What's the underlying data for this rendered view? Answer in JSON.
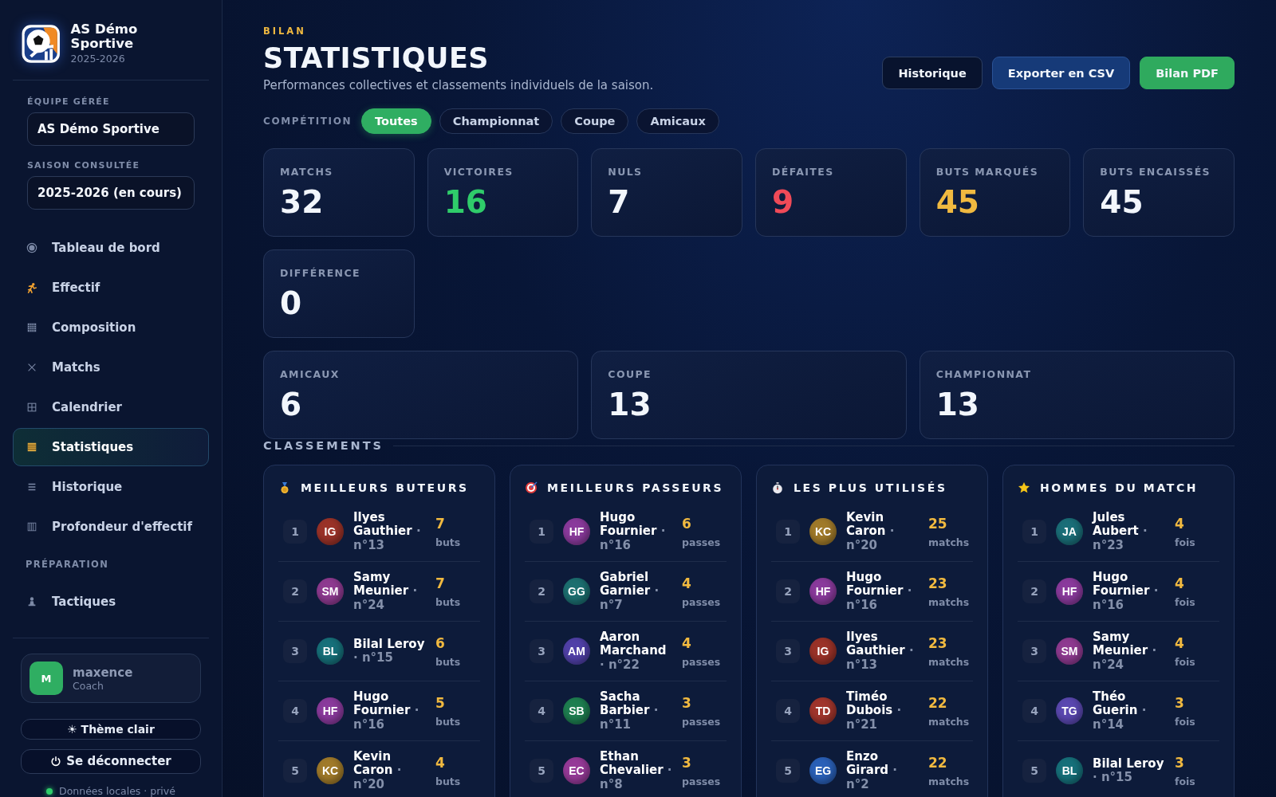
{
  "sidebar": {
    "brand": {
      "name": "AS Démo Sportive",
      "season": "2025-2026"
    },
    "team_field": {
      "label": "ÉQUIPE GÉRÉE",
      "value": "AS Démo Sportive"
    },
    "season_field": {
      "label": "SAISON CONSULTÉE",
      "value": "2025-2026 (en cours)"
    },
    "nav": [
      {
        "label": "Tableau de bord",
        "selected": false
      },
      {
        "label": "Effectif",
        "selected": false
      },
      {
        "label": "Composition",
        "selected": false
      },
      {
        "label": "Matchs",
        "selected": false
      },
      {
        "label": "Calendrier",
        "selected": false
      },
      {
        "label": "Statistiques",
        "selected": true
      },
      {
        "label": "Historique",
        "selected": false
      },
      {
        "label": "Profondeur d'effectif",
        "selected": false
      }
    ],
    "section": "PRÉPARATION",
    "nav_2": [
      {
        "label": "Tactiques",
        "selected": false
      }
    ],
    "user": {
      "initial": "M",
      "name": "maxence",
      "role": "Coach"
    },
    "theme_button": "☀ Thème clair",
    "logout_button": "Se déconnecter",
    "footer": "Données locales · privé"
  },
  "header": {
    "eyebrow": "BILAN",
    "title": "STATISTIQUES",
    "subtitle": "Performances collectives et classements individuels de la saison.",
    "buttons": [
      {
        "label": "Historique",
        "kind": "outline"
      },
      {
        "label": "Exporter en CSV",
        "kind": "secondary"
      },
      {
        "label": "Bilan PDF",
        "kind": "primary"
      }
    ]
  },
  "filter": {
    "label": "COMPÉTITION",
    "options": [
      {
        "label": "Toutes",
        "selected": true
      },
      {
        "label": "Championnat",
        "selected": false
      },
      {
        "label": "Coupe",
        "selected": false
      },
      {
        "label": "Amicaux",
        "selected": false
      }
    ]
  },
  "stats": [
    {
      "label": "MATCHS",
      "value": "32",
      "kind": "neutral"
    },
    {
      "label": "VICTOIRES",
      "value": "16",
      "kind": "positive"
    },
    {
      "label": "NULS",
      "value": "7",
      "kind": "neutral"
    },
    {
      "label": "DÉFAITES",
      "value": "9",
      "kind": "negative"
    },
    {
      "label": "BUTS MARQUÉS",
      "value": "45",
      "kind": "highlight"
    },
    {
      "label": "BUTS ENCAISSÉS",
      "value": "45",
      "kind": "neutral"
    },
    {
      "label": "DIFFÉRENCE",
      "value": "0",
      "kind": "neutral"
    }
  ],
  "competition_stats": [
    {
      "label": "AMICAUX",
      "value": "6"
    },
    {
      "label": "COUPE",
      "value": "13"
    },
    {
      "label": "CHAMPIONNAT",
      "value": "13"
    }
  ],
  "rankings": {
    "title": "CLASSEMENTS",
    "boards": [
      {
        "title": "MEILLEURS BUTEURS",
        "rows": [
          {
            "rank": "1",
            "initials": "IG",
            "color": "#9a3228",
            "name": "Ilyes Gauthier",
            "number": "· n°13",
            "value": "7",
            "unit": "buts"
          },
          {
            "rank": "2",
            "initials": "SM",
            "color": "#8e3a90",
            "name": "Samy Meunier",
            "number": "· n°24",
            "value": "7",
            "unit": "buts"
          },
          {
            "rank": "3",
            "initials": "BL",
            "color": "#16707a",
            "name": "Bilal Leroy",
            "number": "· n°15",
            "value": "6",
            "unit": "buts"
          },
          {
            "rank": "4",
            "initials": "HF",
            "color": "#8a3a9c",
            "name": "Hugo Fournier",
            "number": "· n°16",
            "value": "5",
            "unit": "buts"
          },
          {
            "rank": "5",
            "initials": "KC",
            "color": "#a07a2a",
            "name": "Kevin Caron",
            "number": "· n°20",
            "value": "4",
            "unit": "buts"
          }
        ]
      },
      {
        "title": "MEILLEURS PASSEURS",
        "rows": [
          {
            "rank": "1",
            "initials": "HF",
            "color": "#8a3a9c",
            "name": "Hugo Fournier",
            "number": "· n°16",
            "value": "6",
            "unit": "passes"
          },
          {
            "rank": "2",
            "initials": "GG",
            "color": "#1c6f70",
            "name": "Gabriel Garnier",
            "number": "· n°7",
            "value": "4",
            "unit": "passes"
          },
          {
            "rank": "3",
            "initials": "AM",
            "color": "#5040a8",
            "name": "Aaron Marchand",
            "number": "· n°22",
            "value": "4",
            "unit": "passes"
          },
          {
            "rank": "4",
            "initials": "SB",
            "color": "#1e7e50",
            "name": "Sacha Barbier",
            "number": "· n°11",
            "value": "3",
            "unit": "passes"
          },
          {
            "rank": "5",
            "initials": "EC",
            "color": "#963a98",
            "name": "Ethan Chevalier",
            "number": "· n°8",
            "value": "3",
            "unit": "passes"
          }
        ]
      },
      {
        "title": "LES PLUS UTILISÉS",
        "rows": [
          {
            "rank": "1",
            "initials": "KC",
            "color": "#a07a2a",
            "name": "Kevin Caron",
            "number": "· n°20",
            "value": "25",
            "unit": "matchs"
          },
          {
            "rank": "2",
            "initials": "HF",
            "color": "#8a3a9c",
            "name": "Hugo Fournier",
            "number": "· n°16",
            "value": "23",
            "unit": "matchs"
          },
          {
            "rank": "3",
            "initials": "IG",
            "color": "#9a3228",
            "name": "Ilyes Gauthier",
            "number": "· n°13",
            "value": "23",
            "unit": "matchs"
          },
          {
            "rank": "4",
            "initials": "TD",
            "color": "#a0352c",
            "name": "Timéo Dubois",
            "number": "· n°21",
            "value": "22",
            "unit": "matchs"
          },
          {
            "rank": "5",
            "initials": "EG",
            "color": "#2a60b8",
            "name": "Enzo Girard",
            "number": "· n°2",
            "value": "22",
            "unit": "matchs"
          }
        ]
      },
      {
        "title": "HOMMES DU MATCH",
        "rows": [
          {
            "rank": "1",
            "initials": "JA",
            "color": "#1a6e78",
            "name": "Jules Aubert",
            "number": "· n°23",
            "value": "4",
            "unit": "fois"
          },
          {
            "rank": "2",
            "initials": "HF",
            "color": "#8a3a9c",
            "name": "Hugo Fournier",
            "number": "· n°16",
            "value": "4",
            "unit": "fois"
          },
          {
            "rank": "3",
            "initials": "SM",
            "color": "#8e3a90",
            "name": "Samy Meunier",
            "number": "· n°24",
            "value": "4",
            "unit": "fois"
          },
          {
            "rank": "4",
            "initials": "TG",
            "color": "#5a48b0",
            "name": "Théo Guerin",
            "number": "· n°14",
            "value": "3",
            "unit": "fois"
          },
          {
            "rank": "5",
            "initials": "BL",
            "color": "#16707a",
            "name": "Bilal Leroy",
            "number": "· n°15",
            "value": "3",
            "unit": "fois"
          }
        ]
      }
    ]
  }
}
